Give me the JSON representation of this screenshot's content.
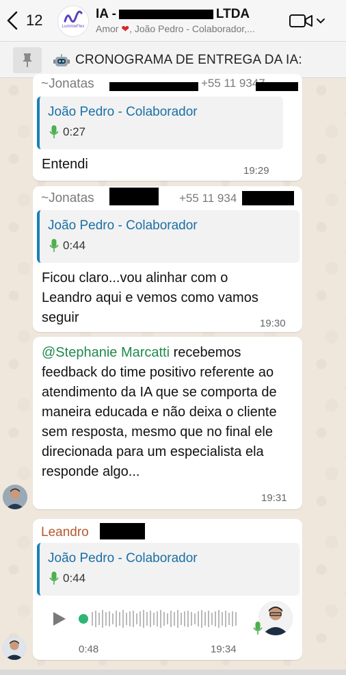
{
  "header": {
    "back_count": "12",
    "title_prefix": "IA -",
    "title_suffix": "LTDA",
    "logo_text": "LummieFlex",
    "subtitle_part1": "Amor",
    "subtitle_part2": ", João Pedro - Colaborador,..."
  },
  "pinned": {
    "text": "CRONOGRAMA DE ENTREGA DA IA:"
  },
  "messages": [
    {
      "sender": "~Jonatas",
      "phone": "+55 11 9347",
      "quote_name": "João Pedro - Colaborador",
      "quote_duration": "0:27",
      "text": "Entendi",
      "time": "19:29"
    },
    {
      "sender": "~Jonatas",
      "phone": "+55 11 934",
      "quote_name": "João Pedro - Colaborador",
      "quote_duration": "0:44",
      "text": "Ficou claro...vou alinhar com o Leandro aqui e vemos como vamos seguir",
      "time": "19:30"
    },
    {
      "mention": "@Stephanie Marcatti",
      "text": " recebemos feedback do time positivo referente ao atendimento da IA que se comporta de maneira educada e não deixa o cliente sem resposta, mesmo que no final ele direcionada para um especialista ela responde algo...",
      "time": "19:31"
    },
    {
      "sender": "Leandro",
      "quote_name": "João Pedro - Colaborador",
      "quote_duration": "0:44",
      "audio_duration": "0:48",
      "time": "19:34"
    }
  ],
  "colors": {
    "quote_accent": "#1a7fb8",
    "mention": "#1e8a4c",
    "sender_jonatas": "#7a7a7a",
    "sender_leandro": "#b8572a"
  }
}
